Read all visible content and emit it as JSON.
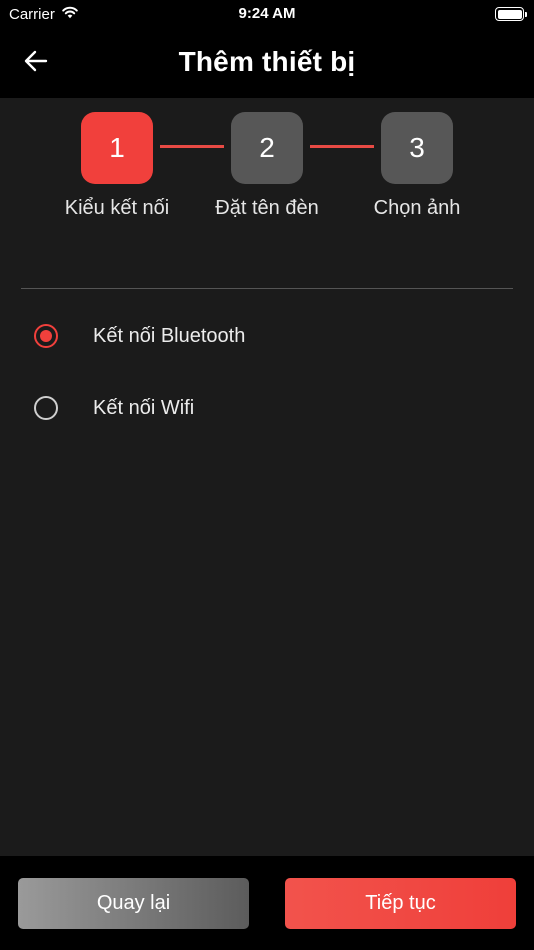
{
  "status_bar": {
    "carrier": "Carrier",
    "time": "9:24 AM"
  },
  "nav": {
    "title": "Thêm thiết bị",
    "back_icon": "arrow-left-icon"
  },
  "steps": [
    {
      "number": "1",
      "label": "Kiểu kết nối",
      "state": "active"
    },
    {
      "number": "2",
      "label": "Đặt tên đèn",
      "state": "inactive"
    },
    {
      "number": "3",
      "label": "Chọn ảnh",
      "state": "inactive"
    }
  ],
  "options": [
    {
      "label": "Kết nối Bluetooth",
      "selected": true
    },
    {
      "label": "Kết nối Wifi",
      "selected": false
    }
  ],
  "buttons": {
    "back_label": "Quay lại",
    "next_label": "Tiếp tục"
  },
  "colors": {
    "accent": "#f1403c",
    "background": "#1b1b1b",
    "bar_background": "#000000",
    "inactive_step": "#575757"
  }
}
